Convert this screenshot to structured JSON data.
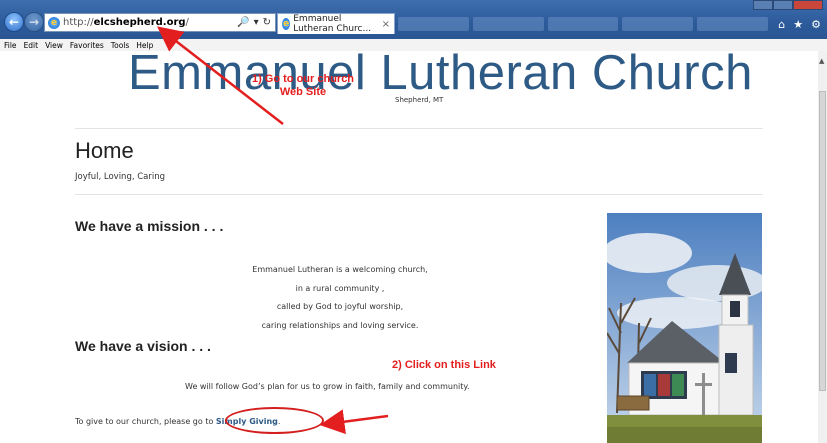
{
  "browser": {
    "url_prefix": "http://",
    "url_domain": "elcshepherd.org",
    "url_suffix": "/",
    "search_icon": "🔎",
    "dropdown_icon": "▾",
    "refresh_icon": "↻",
    "tab_title": "Emmanuel Lutheran Churc...",
    "tab_close": "×",
    "back_icon": "←",
    "forward_icon": "→",
    "home_icon": "⌂",
    "star_icon": "★",
    "gear_icon": "⚙"
  },
  "menu": [
    "File",
    "Edit",
    "View",
    "Favorites",
    "Tools",
    "Help"
  ],
  "site": {
    "title": "Emmanuel Lutheran Church",
    "tagline": "Shepherd, MT",
    "page_title": "Home",
    "page_subtitle": "Joyful, Loving, Caring"
  },
  "content": {
    "mission_heading": "We have a mission . . .",
    "mission_lines": [
      "Emmanuel Lutheran is a welcoming church,",
      "in a rural community ,",
      "called by God to joyful worship,",
      "caring relationships and loving service."
    ],
    "vision_heading": "We have a vision . . .",
    "vision_text": "We will follow God’s plan for us to grow in faith, family and community.",
    "give_text": "To give to our church, please go to ",
    "give_link": "Simply Giving",
    "give_end": "."
  },
  "annotations": {
    "step1_line1": "1) Go to our church",
    "step1_line2": "Web Site",
    "step2": "2) Click on this Link",
    "color": "#e31e1e"
  },
  "colors": {
    "title_blue": "#2e5a86",
    "chrome_blue": "#2c5a9a"
  }
}
